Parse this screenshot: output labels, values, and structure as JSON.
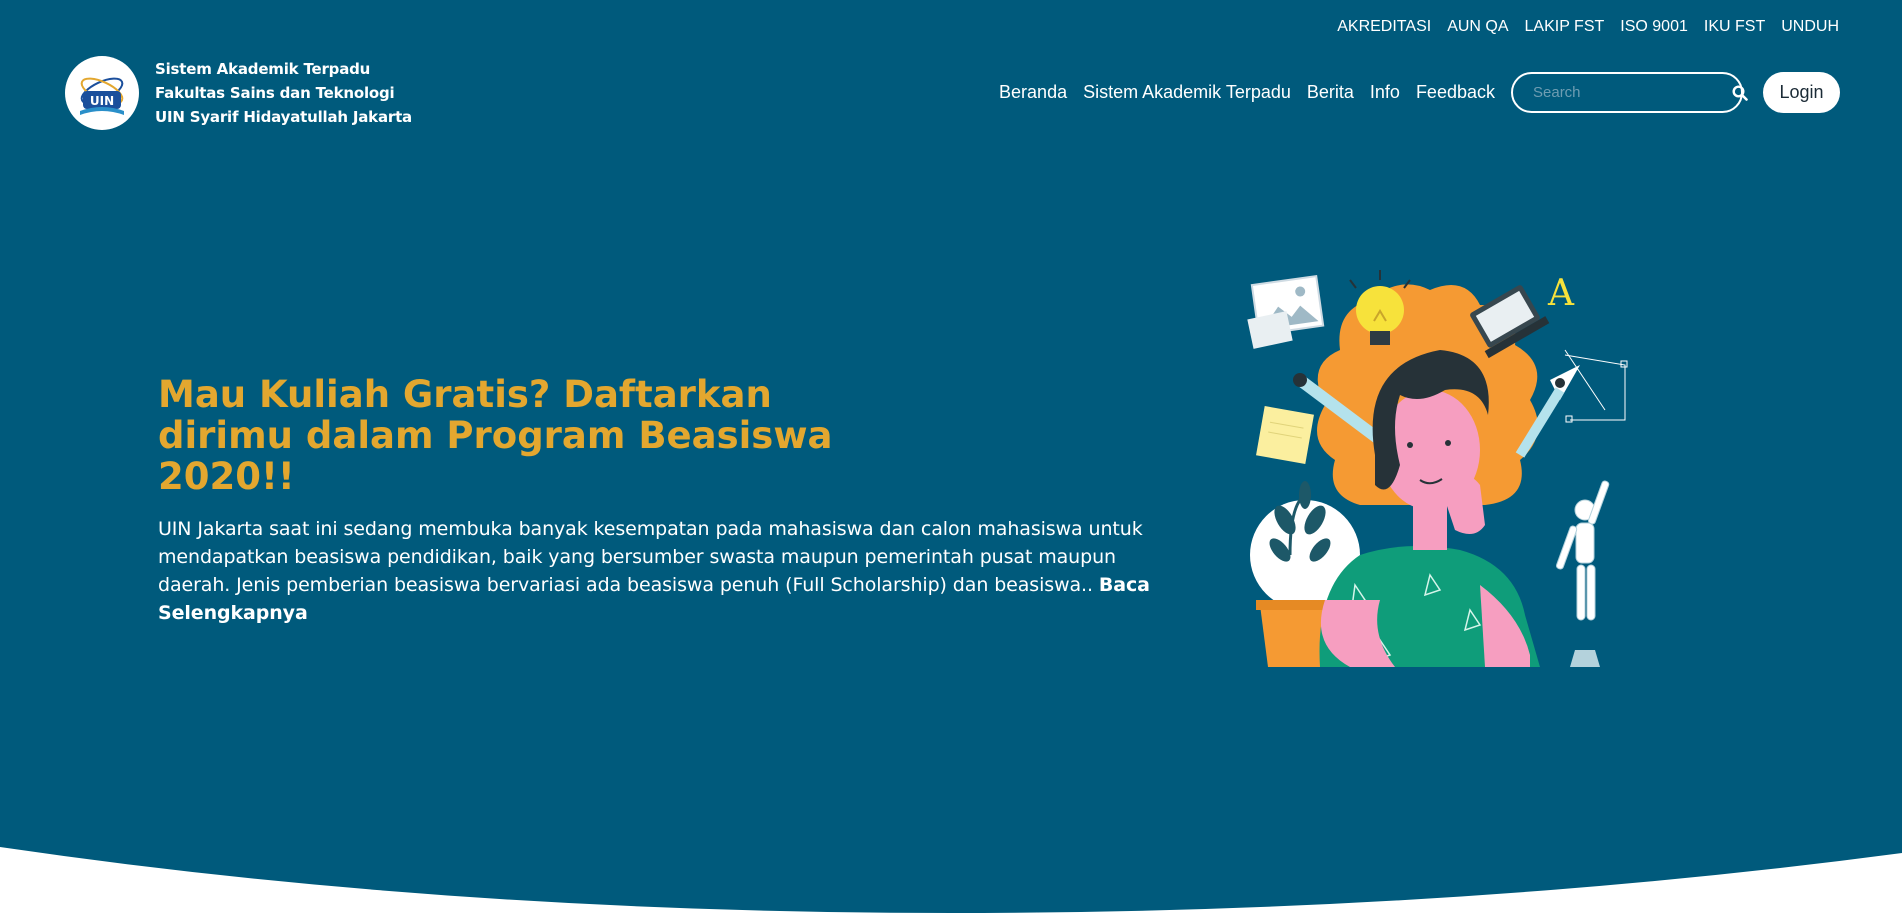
{
  "top_links": [
    "AKREDITASI",
    "AUN QA",
    "LAKIP FST",
    "ISO 9001",
    "IKU FST",
    "UNDUH"
  ],
  "brand": {
    "line1": "Sistem Akademik Terpadu",
    "line2": "Fakultas Sains dan Teknologi",
    "line3": "UIN Syarif Hidayatullah Jakarta",
    "logo_text": "UIN"
  },
  "nav": [
    "Beranda",
    "Sistem Akademik Terpadu",
    "Berita",
    "Info",
    "Feedback"
  ],
  "search": {
    "placeholder": "Search"
  },
  "login_label": "Login",
  "hero": {
    "title": "Mau Kuliah Gratis? Daftarkan dirimu dalam Program Beasiswa 2020!!",
    "description": "UIN Jakarta saat ini sedang membuka banyak kesempatan pada mahasiswa dan calon mahasiswa untuk mendapatkan beasiswa pendidikan, baik yang bersumber swasta maupun pemerintah pusat maupun daerah. Jenis pemberian beasiswa bervariasi ada beasiswa penuh (Full Scholarship) dan beasiswa.. ",
    "read_more": "Baca Selengkapnya",
    "illustration_letter": "A"
  },
  "colors": {
    "background": "#005a7c",
    "title_accent": "#e3a72f",
    "wave": "#ffffff"
  },
  "icons": [
    "search-icon",
    "uin-logo-icon"
  ]
}
